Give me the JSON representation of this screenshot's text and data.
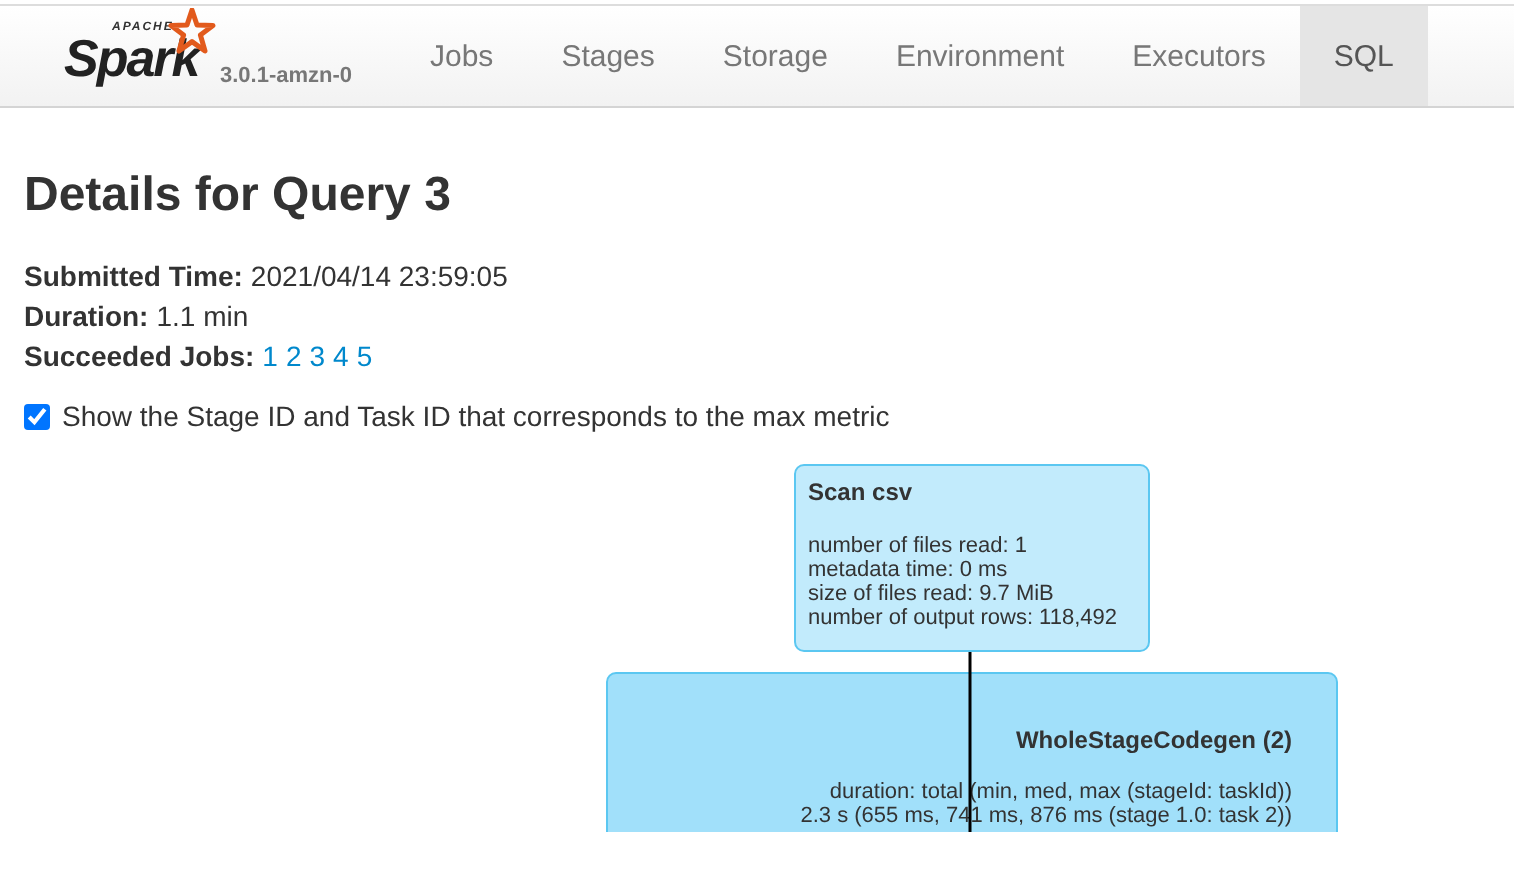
{
  "brand": {
    "apache": "APACHE",
    "name": "Spark",
    "version": "3.0.1-amzn-0"
  },
  "tabs": [
    {
      "label": "Jobs",
      "selected": false
    },
    {
      "label": "Stages",
      "selected": false
    },
    {
      "label": "Storage",
      "selected": false
    },
    {
      "label": "Environment",
      "selected": false
    },
    {
      "label": "Executors",
      "selected": false
    },
    {
      "label": "SQL",
      "selected": true
    }
  ],
  "title": "Details for Query 3",
  "summary": [
    {
      "label": "Submitted Time:",
      "value": "2021/04/14 23:59:05"
    },
    {
      "label": "Duration:",
      "value": "1.1 min"
    },
    {
      "label": "Succeeded Jobs:",
      "links": [
        "1",
        "2",
        "3",
        "4",
        "5"
      ]
    }
  ],
  "max_metric_option": {
    "label": "Show the Stage ID and Task ID that corresponds to the max metric",
    "checked": true
  },
  "graph": {
    "nodes": [
      {
        "kind": "operator",
        "title": "Scan csv",
        "lines": [
          "number of files read: 1",
          "metadata time: 0 ms",
          "size of files read: 9.7 MiB",
          "number of output rows: 118,492"
        ]
      },
      {
        "kind": "cluster",
        "title": "WholeStageCodegen (2)",
        "lines": [
          "duration: total (min, med, max (stageId: taskId))",
          "2.3 s (655 ms, 741 ms, 876 ms (stage 1.0: task 2))"
        ]
      }
    ]
  }
}
